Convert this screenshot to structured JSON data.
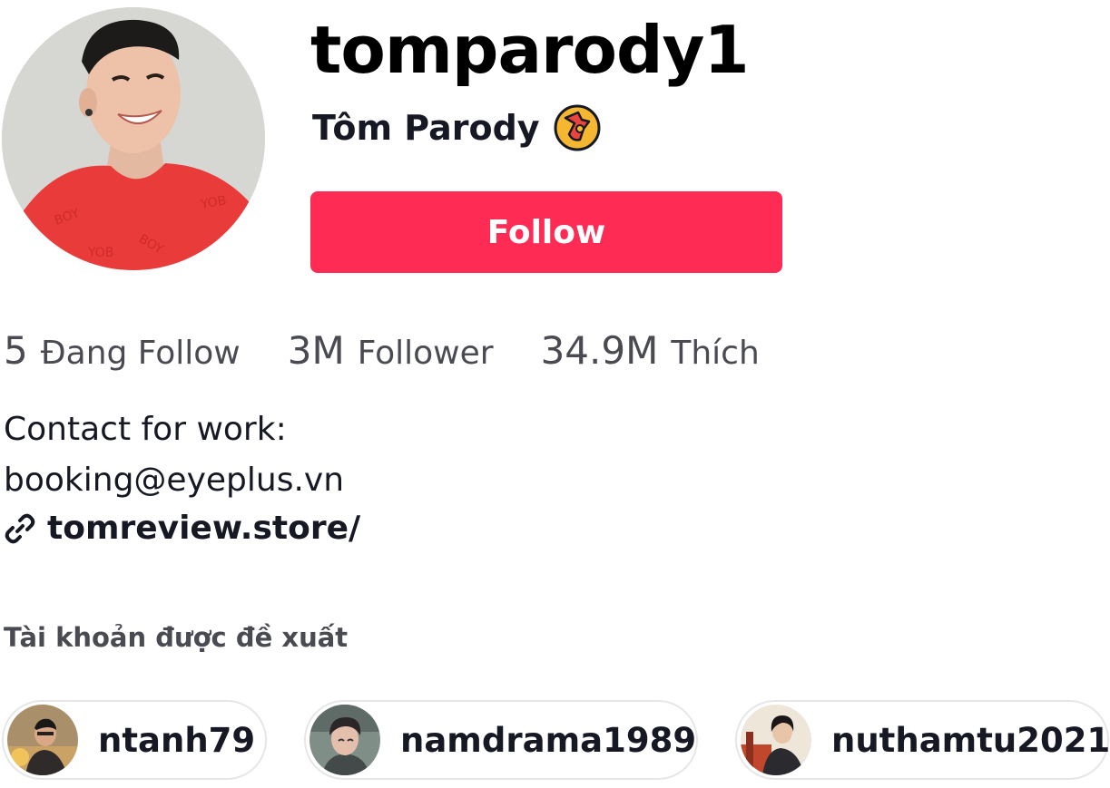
{
  "profile": {
    "username": "tomparody1",
    "nickname": "Tôm Parody",
    "follow_label": "Follow"
  },
  "stats": [
    {
      "value": "5",
      "label": "Đang Follow"
    },
    {
      "value": "3M",
      "label": "Follower"
    },
    {
      "value": "34.9M",
      "label": "Thích"
    }
  ],
  "bio": {
    "line1": "Contact for work:",
    "line2": "booking@eyeplus.vn"
  },
  "link": {
    "text": "tomreview.store/",
    "icon": "link-icon"
  },
  "suggested": {
    "title": "Tài khoản được đề xuất",
    "accounts": [
      {
        "name": "ntanh79"
      },
      {
        "name": "namdrama1989"
      },
      {
        "name": "nuthamtu2021"
      }
    ]
  },
  "colors": {
    "accent": "#fe2c55",
    "text": "#161823",
    "muted": "#4a4b52",
    "chip_border": "#e6e6e8"
  }
}
